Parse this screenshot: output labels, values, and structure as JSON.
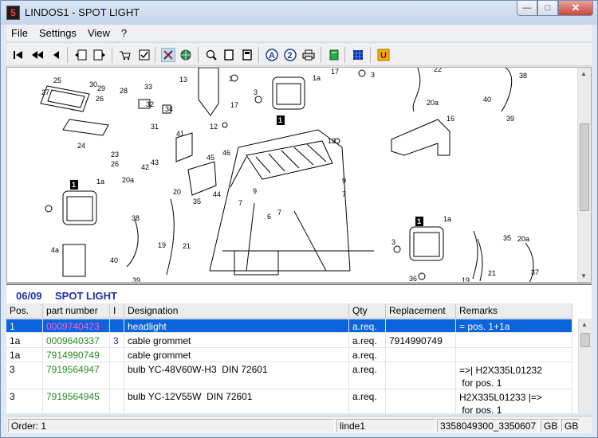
{
  "window": {
    "title": "LINDOS1 - SPOT LIGHT",
    "icon_letter": "5"
  },
  "menu": [
    "File",
    "Settings",
    "View",
    "?"
  ],
  "toolbar": {
    "icons": [
      "first-icon",
      "previous-group-icon",
      "previous-icon",
      "book-back-icon",
      "book-forward-icon",
      "cart-icon",
      "checklist-icon",
      "tools-icon",
      "globe-icon",
      "zoom-icon",
      "page-icon",
      "page-alt-icon",
      "text-a-icon",
      "text-2-icon",
      "print-icon",
      "green-book-icon",
      "grid-icon",
      "u-icon"
    ]
  },
  "drawing": {
    "callouts": [
      "25",
      "30",
      "29",
      "28",
      "33",
      "32",
      "27",
      "26",
      "34",
      "31",
      "24",
      "23",
      "26",
      "42",
      "43",
      "41",
      "45",
      "46",
      "44",
      "20a",
      "1a",
      "20",
      "35",
      "38",
      "19",
      "21",
      "40",
      "4a",
      "39",
      "13",
      "36",
      "3",
      "17",
      "12",
      "1a",
      "17",
      "3",
      "22",
      "38",
      "20a",
      "40",
      "39",
      "16",
      "12",
      "9",
      "7",
      "6",
      "7",
      "9",
      "7",
      "1a",
      "3",
      "36",
      "35",
      "20a",
      "37",
      "19",
      "21",
      "1",
      "1",
      "1"
    ]
  },
  "section": {
    "number": "06/09",
    "title": "SPOT LIGHT"
  },
  "grid": {
    "columns": [
      "Pos.",
      "part number",
      "I",
      "Designation",
      "Qty",
      "Replacement",
      "Remarks"
    ],
    "rows": [
      {
        "pos": "1",
        "part": "0009740423",
        "i": "",
        "designation": "headlight",
        "qty": "a.req.",
        "replacement": "",
        "remarks": "= pos. 1+1a"
      },
      {
        "pos": "1a",
        "part": "0009640337",
        "i": "3",
        "designation": "cable grommet",
        "qty": "a.req.",
        "replacement": "7914990749",
        "remarks": ""
      },
      {
        "pos": "1a",
        "part": "7914990749",
        "i": "",
        "designation": "cable grommet",
        "qty": "a.req.",
        "replacement": "",
        "remarks": ""
      },
      {
        "pos": "3",
        "part": "7919564947",
        "i": "",
        "designation": "bulb YC-48V60W-H3  DIN 72601",
        "qty": "a.req.",
        "replacement": "",
        "remarks": "=>| H2X335L01232\n for pos. 1"
      },
      {
        "pos": "3",
        "part": "7919564945",
        "i": "",
        "designation": "bulb YC-12V55W  DIN 72601",
        "qty": "a.req.",
        "replacement": "",
        "remarks": "H2X335L01233 |=>\n for pos. 1"
      }
    ]
  },
  "status": {
    "order": "Order: 1",
    "user": "linde1",
    "codes": "3358049300_3350607",
    "lang1": "GB",
    "lang2": "GB"
  }
}
